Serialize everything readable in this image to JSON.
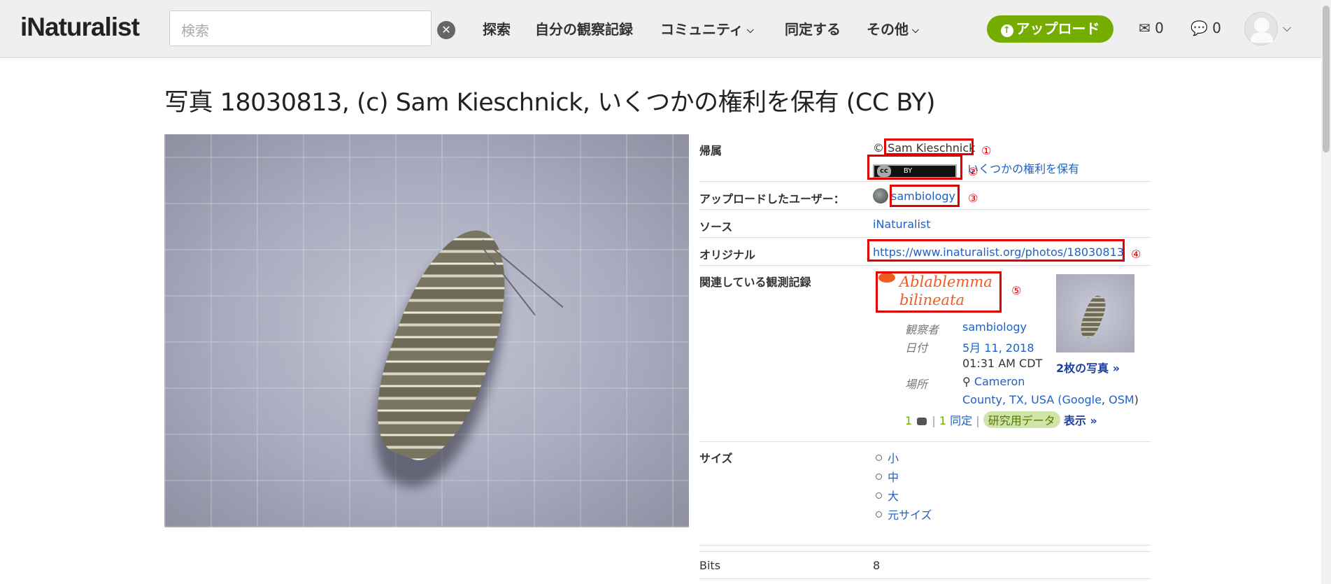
{
  "header": {
    "logo": "iNaturalist",
    "search_placeholder": "検索",
    "clear_glyph": "✕",
    "nav": [
      "探索",
      "自分の観察記録",
      "コミュニティ",
      "同定する",
      "その他"
    ],
    "upload_label": "アップロード",
    "messages_count": "0",
    "notifications_count": "0"
  },
  "page": {
    "title": "写真 18030813, (c) Sam Kieschnick, いくつかの権利を保有 (CC BY)"
  },
  "info": {
    "attribution": {
      "label": "帰属",
      "copyright_symbol": "©",
      "author": "Sam Kieschnick",
      "license_badge": "BY",
      "license_badge_cc": "cc",
      "rights_link": "いくつかの権利を保有",
      "markers": [
        "①",
        "②"
      ]
    },
    "uploader": {
      "label": "アップロードしたユーザー：",
      "user": "sambiology",
      "marker": "③"
    },
    "source": {
      "label": "ソース",
      "value": "iNaturalist"
    },
    "original": {
      "label": "オリジナル",
      "url": "https://www.inaturalist.org/photos/18030813",
      "marker": "④"
    },
    "related": {
      "label": "関連している観測記録",
      "taxon_line1": "Ablablemma",
      "taxon_line2": "bilineata",
      "marker": "⑤",
      "observer_key": "観察者",
      "observer": "sambiology",
      "date_key": "日付",
      "date": "5月 11, 2018",
      "time": "01:31 AM CDT",
      "place_key": "場所",
      "place_line1": "Cameron",
      "place_line2_a": "County, TX, USA (",
      "google": "Google",
      "comma": ", ",
      "osm": "OSM",
      "place_close": ")",
      "comments": "1",
      "ids_count": "1",
      "ids_label": "同定",
      "separator": "|",
      "quality": "研究用データ",
      "show": "表示 »",
      "photos_link": "2枚の写真 »"
    },
    "sizes": {
      "label": "サイズ",
      "items": [
        "小",
        "中",
        "大",
        "元サイズ"
      ]
    },
    "bits": {
      "label": "Bits",
      "value": "8"
    }
  },
  "colors": {
    "brand_green": "#74ac00",
    "link": "#1f61c4",
    "annotation_red": "#e00000",
    "taxon_orange": "#f15b22"
  },
  "icons": [
    "search-clear-icon",
    "chevron-down-icon",
    "upload-arrow-icon",
    "envelope-icon",
    "comment-icon",
    "map-marker-icon",
    "insect-icon"
  ]
}
